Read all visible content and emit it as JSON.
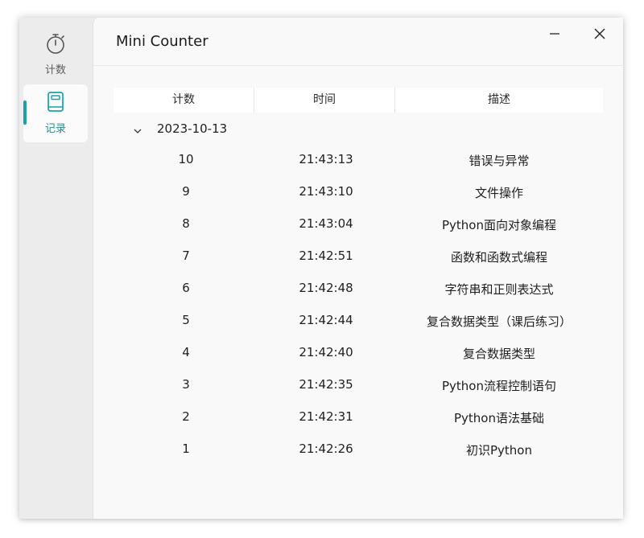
{
  "window": {
    "title": "Mini Counter"
  },
  "sidebar": {
    "items": [
      {
        "label": "计数",
        "icon": "stopwatch-icon",
        "selected": false
      },
      {
        "label": "记录",
        "icon": "notebook-icon",
        "selected": true
      }
    ]
  },
  "table": {
    "columns": [
      "计数",
      "时间",
      "描述"
    ],
    "groups": [
      {
        "date": "2023-10-13",
        "expanded": true,
        "rows": [
          {
            "count": "10",
            "time": "21:43:13",
            "desc": "错误与异常"
          },
          {
            "count": "9",
            "time": "21:43:10",
            "desc": "文件操作"
          },
          {
            "count": "8",
            "time": "21:43:04",
            "desc": "Python面向对象编程"
          },
          {
            "count": "7",
            "time": "21:42:51",
            "desc": "函数和函数式编程"
          },
          {
            "count": "6",
            "time": "21:42:48",
            "desc": "字符串和正则表达式"
          },
          {
            "count": "5",
            "time": "21:42:44",
            "desc": "复合数据类型（课后练习）"
          },
          {
            "count": "4",
            "time": "21:42:40",
            "desc": "复合数据类型"
          },
          {
            "count": "3",
            "time": "21:42:35",
            "desc": "Python流程控制语句"
          },
          {
            "count": "2",
            "time": "21:42:31",
            "desc": "Python语法基础"
          },
          {
            "count": "1",
            "time": "21:42:26",
            "desc": "初识Python"
          }
        ]
      }
    ]
  },
  "colors": {
    "accent": "#19a2a2",
    "sidebar_bg": "#ececec",
    "content_bg": "#f9f9f9"
  }
}
